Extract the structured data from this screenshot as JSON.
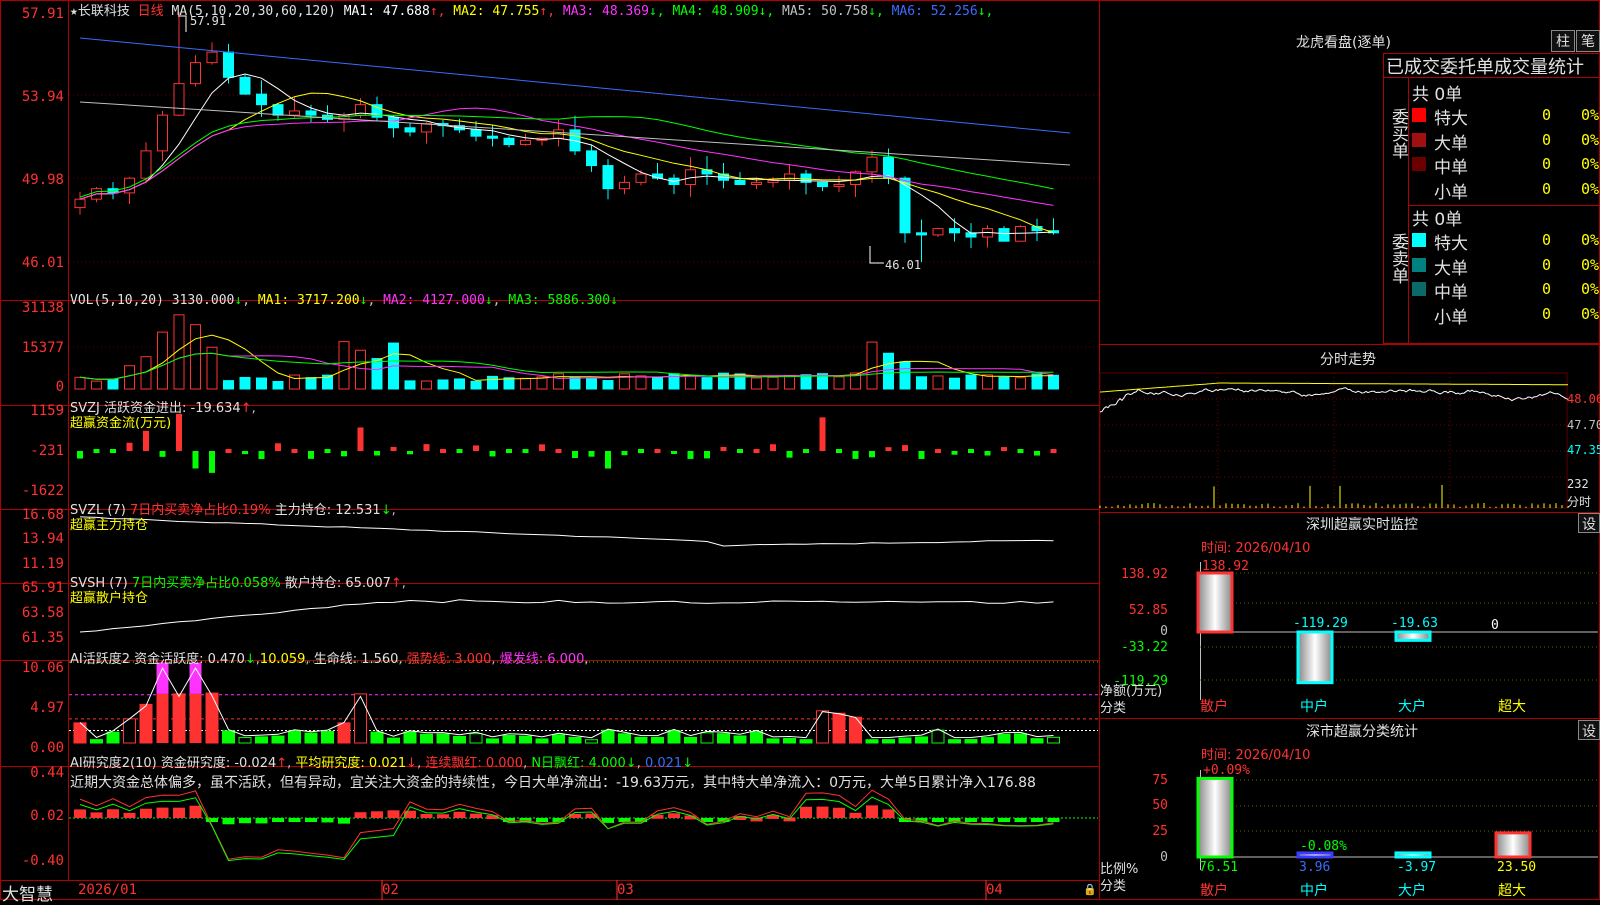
{
  "stock": {
    "name": "长联科技",
    "period": "日线",
    "ma_header": "MA(5,10,20,30,60,120)",
    "ma_values": [
      {
        "label": "MA1: 47.688",
        "arrow": "↑",
        "color": "#ffffff"
      },
      {
        "label": "MA2: 47.755",
        "arrow": "↑",
        "color": "#ffff00"
      },
      {
        "label": "MA3: 48.369",
        "arrow": "↓",
        "color": "#ff33ff"
      },
      {
        "label": "MA4: 48.909",
        "arrow": "↓",
        "color": "#00ff00"
      },
      {
        "label": "MA5: 50.758",
        "arrow": "↓",
        "color": "#c0c0c0"
      },
      {
        "label": "MA6: 52.256",
        "arrow": "↓",
        "color": "#3a6cff"
      }
    ],
    "high_mark": "57.91",
    "low_mark": "46.01",
    "price_axis": [
      "57.91",
      "53.94",
      "49.98",
      "46.01"
    ]
  },
  "vol": {
    "header": "VOL(5,10,20)",
    "value": "3130.000",
    "ma1": "MA1: 3717.200",
    "ma2": "MA2: 4127.000",
    "ma3": "MA3: 5886.300",
    "axis": [
      "31138",
      "15377",
      "0"
    ]
  },
  "svzj": {
    "header": "SVZJ  活跃资金进出: -19.634",
    "sub": "超赢资金流(万元)",
    "axis": [
      "1159",
      "-231",
      "-1622"
    ]
  },
  "svzl": {
    "header": "SVZL (7)",
    "ratio": "7日内买卖净占比0.19%",
    "hold": "主力持仓: 12.531",
    "sub": "超赢主力持仓",
    "axis": [
      "16.68",
      "13.94",
      "11.19"
    ]
  },
  "svsh": {
    "header": "SVSH (7)",
    "ratio": "7日内买卖净占比0.058%",
    "hold": "散户持仓: 65.007",
    "sub": "超赢散户持仓",
    "axis": [
      "65.91",
      "63.58",
      "61.35"
    ]
  },
  "ai1": {
    "header": "AI活跃度2",
    "active": "资金活跃度: 0.470",
    "v2": "10.059",
    "life": "生命线: 1.560",
    "strong": "强势线: 3.000",
    "burst": "爆发线: 6.000",
    "axis": [
      "10.06",
      "4.97",
      "0.00"
    ]
  },
  "ai2": {
    "header": "AI研究度2(10)",
    "research": "资金研究度: -0.024",
    "avg": "平均研究度: 0.021",
    "cont": "连续飘红: 0.000",
    "nday": "N日飘红: 4.000",
    "last": "0.021",
    "comment": "近期大资金总体偏多，虽不活跃，但有异动，宜关注大资金的持续性，今日大单净流出：-19.63万元，其中特大单净流入：0万元，大单5日累计净入176.88",
    "axis": [
      "0.44",
      "0.02",
      "-0.40"
    ]
  },
  "dates": [
    "2026/01",
    "02",
    "03",
    "04"
  ],
  "logo": "大智慧",
  "right": {
    "lhb_title": "龙虎看盘(逐单)",
    "btn_bar": "柱",
    "btn_pen": "笔",
    "stat_title": "已成交委托单成交量统计",
    "buy": {
      "side": "委买单",
      "total": "共 0单",
      "rows": [
        {
          "name": "特大",
          "val": "0",
          "pct": "0%",
          "color": "#ff0000"
        },
        {
          "name": "大单",
          "val": "0",
          "pct": "0%",
          "color": "#a01010"
        },
        {
          "name": "中单",
          "val": "0",
          "pct": "0%",
          "color": "#6a0000"
        },
        {
          "name": "小单",
          "val": "0",
          "pct": "0%",
          "color": ""
        }
      ]
    },
    "sell": {
      "side": "委卖单",
      "total": "共 0单",
      "rows": [
        {
          "name": "特大",
          "val": "0",
          "pct": "0%",
          "color": "#00ffff"
        },
        {
          "name": "大单",
          "val": "0",
          "pct": "0%",
          "color": "#008080"
        },
        {
          "name": "中单",
          "val": "0",
          "pct": "0%",
          "color": "#0a6a6a"
        },
        {
          "name": "小单",
          "val": "0",
          "pct": "0%",
          "color": ""
        }
      ]
    },
    "fs_title": "分时走势",
    "fs_axis": [
      "48.06",
      "47.70",
      "47.35"
    ],
    "fs_vol": "232",
    "fs_unit": "分时",
    "monitor": {
      "title": "深圳超赢实时监控",
      "btn": "设",
      "time": "时间: 2026/04/10",
      "axis": [
        "138.92",
        "52.85",
        "0",
        "-33.22",
        "-119.29"
      ],
      "values": [
        "138.92",
        "-119.29",
        "-19.63",
        "0"
      ],
      "unit": "净额(万元)",
      "cat_label": "分类",
      "cats": [
        "散户",
        "中户",
        "大户",
        "超大"
      ]
    },
    "classify": {
      "title": "深市超赢分类统计",
      "btn": "设",
      "time": "时间: 2026/04/10",
      "axis": [
        "75",
        "50",
        "25",
        "0"
      ],
      "top": [
        "+0.09%",
        "-0.08%"
      ],
      "values": [
        "76.51",
        "3.96",
        "-3.97",
        "23.50"
      ],
      "unit": "比例%",
      "cat_label": "分类",
      "cats": [
        "散户",
        "中户",
        "大户",
        "超大"
      ]
    }
  }
}
